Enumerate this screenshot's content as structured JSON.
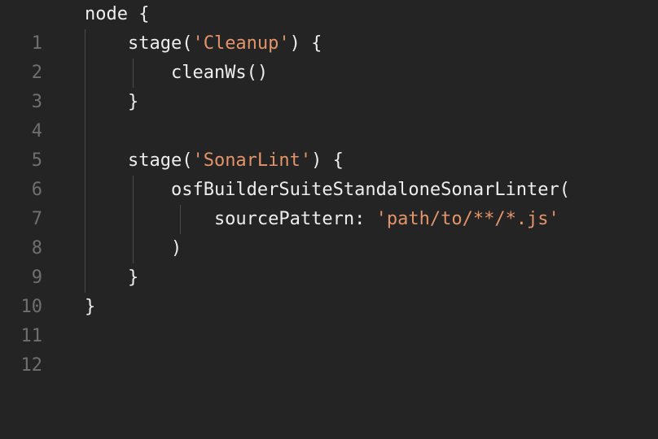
{
  "editor": {
    "theme": {
      "background": "#242424",
      "text": "#ededed",
      "string": "#e3946a",
      "line_number": "#6f6f6f",
      "indent_guide": "#4a4a4a"
    },
    "lines": [
      {
        "number": "1",
        "segments": [
          {
            "type": "plain",
            "text": "node {"
          }
        ]
      },
      {
        "number": "2",
        "segments": [
          {
            "type": "plain",
            "text": "    stage("
          },
          {
            "type": "string",
            "text": "'Cleanup'"
          },
          {
            "type": "plain",
            "text": ") {"
          }
        ]
      },
      {
        "number": "3",
        "segments": [
          {
            "type": "plain",
            "text": "        cleanWs()"
          }
        ]
      },
      {
        "number": "4",
        "segments": [
          {
            "type": "plain",
            "text": "    }"
          }
        ]
      },
      {
        "number": "5",
        "segments": [
          {
            "type": "plain",
            "text": ""
          }
        ]
      },
      {
        "number": "6",
        "segments": [
          {
            "type": "plain",
            "text": "    stage("
          },
          {
            "type": "string",
            "text": "'SonarLint'"
          },
          {
            "type": "plain",
            "text": ") {"
          }
        ]
      },
      {
        "number": "7",
        "segments": [
          {
            "type": "plain",
            "text": "        osfBuilderSuiteStandaloneSonarLinter("
          }
        ]
      },
      {
        "number": "8",
        "segments": [
          {
            "type": "plain",
            "text": "            sourcePattern: "
          },
          {
            "type": "string",
            "text": "'path/to/**/*.js'"
          }
        ]
      },
      {
        "number": "9",
        "segments": [
          {
            "type": "plain",
            "text": "        )"
          }
        ]
      },
      {
        "number": "10",
        "segments": [
          {
            "type": "plain",
            "text": "    }"
          }
        ]
      },
      {
        "number": "11",
        "segments": [
          {
            "type": "plain",
            "text": "}"
          }
        ]
      },
      {
        "number": "12",
        "segments": [
          {
            "type": "plain",
            "text": ""
          }
        ]
      }
    ]
  }
}
